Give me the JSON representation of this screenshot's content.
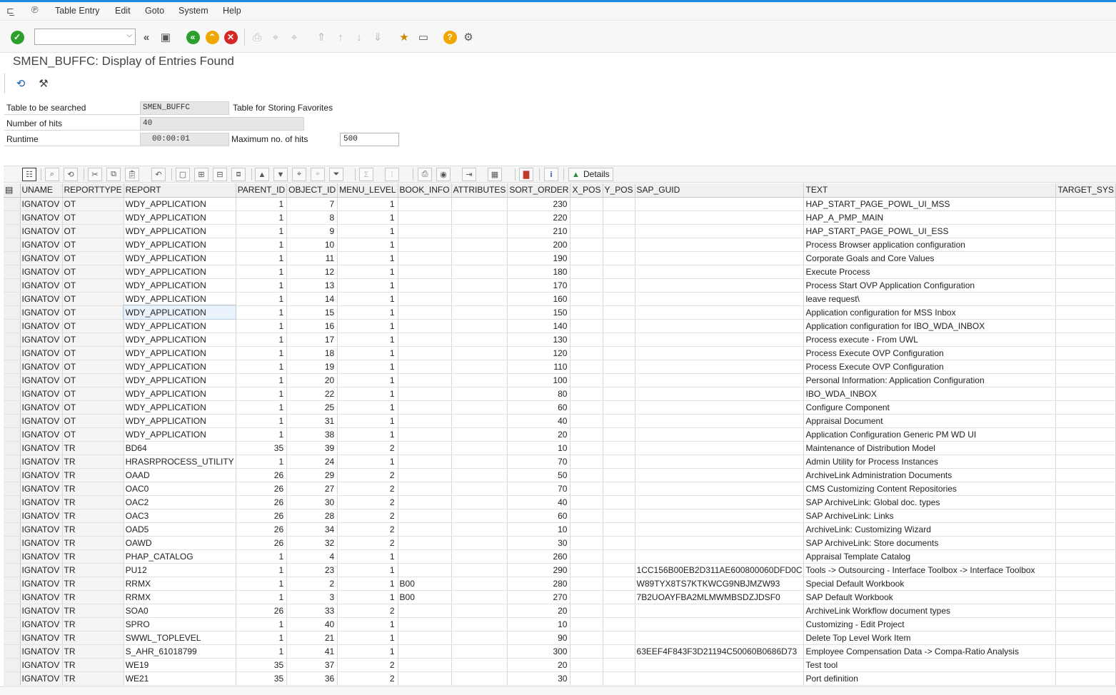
{
  "menu": {
    "items": [
      "Table Entry",
      "Edit",
      "Goto",
      "System",
      "Help"
    ]
  },
  "toolbar": {
    "command_field_value": ""
  },
  "page": {
    "title": "SMEN_BUFFC: Display of Entries Found"
  },
  "header": {
    "table_label": "Table to be searched",
    "table_value": "SMEN_BUFFC",
    "table_desc": "Table for Storing Favorites",
    "hits_label": "Number of hits",
    "hits_value": "40",
    "runtime_label": "Runtime",
    "runtime_value": "00:00:01",
    "maxhits_label": "Maximum no. of hits",
    "maxhits_value": "500"
  },
  "grid_toolbar": {
    "details_label": "Details"
  },
  "table": {
    "columns": [
      "UNAME",
      "REPORTTYPE",
      "REPORT",
      "PARENT_ID",
      "OBJECT_ID",
      "MENU_LEVEL",
      "BOOK_INFO",
      "ATTRIBUTES",
      "SORT_ORDER",
      "X_POS",
      "Y_POS",
      "SAP_GUID",
      "TEXT",
      "TARGET_SYS"
    ],
    "rows": [
      [
        "IGNATOV",
        "OT",
        "WDY_APPLICATION",
        "1",
        "7",
        "1",
        "",
        "",
        "230",
        "",
        "",
        "",
        "HAP_START_PAGE_POWL_UI_MSS",
        ""
      ],
      [
        "IGNATOV",
        "OT",
        "WDY_APPLICATION",
        "1",
        "8",
        "1",
        "",
        "",
        "220",
        "",
        "",
        "",
        "HAP_A_PMP_MAIN",
        ""
      ],
      [
        "IGNATOV",
        "OT",
        "WDY_APPLICATION",
        "1",
        "9",
        "1",
        "",
        "",
        "210",
        "",
        "",
        "",
        "HAP_START_PAGE_POWL_UI_ESS",
        ""
      ],
      [
        "IGNATOV",
        "OT",
        "WDY_APPLICATION",
        "1",
        "10",
        "1",
        "",
        "",
        "200",
        "",
        "",
        "",
        "Process Browser application configuration",
        ""
      ],
      [
        "IGNATOV",
        "OT",
        "WDY_APPLICATION",
        "1",
        "11",
        "1",
        "",
        "",
        "190",
        "",
        "",
        "",
        "Corporate Goals and Core Values",
        ""
      ],
      [
        "IGNATOV",
        "OT",
        "WDY_APPLICATION",
        "1",
        "12",
        "1",
        "",
        "",
        "180",
        "",
        "",
        "",
        "Execute Process",
        ""
      ],
      [
        "IGNATOV",
        "OT",
        "WDY_APPLICATION",
        "1",
        "13",
        "1",
        "",
        "",
        "170",
        "",
        "",
        "",
        "Process Start OVP Application Configuration",
        ""
      ],
      [
        "IGNATOV",
        "OT",
        "WDY_APPLICATION",
        "1",
        "14",
        "1",
        "",
        "",
        "160",
        "",
        "",
        "",
        "leave request\\",
        ""
      ],
      [
        "IGNATOV",
        "OT",
        "WDY_APPLICATION",
        "1",
        "15",
        "1",
        "",
        "",
        "150",
        "",
        "",
        "",
        "Application configuration for MSS Inbox",
        ""
      ],
      [
        "IGNATOV",
        "OT",
        "WDY_APPLICATION",
        "1",
        "16",
        "1",
        "",
        "",
        "140",
        "",
        "",
        "",
        "Application configuration for IBO_WDA_INBOX",
        ""
      ],
      [
        "IGNATOV",
        "OT",
        "WDY_APPLICATION",
        "1",
        "17",
        "1",
        "",
        "",
        "130",
        "",
        "",
        "",
        "Process execute - From UWL",
        ""
      ],
      [
        "IGNATOV",
        "OT",
        "WDY_APPLICATION",
        "1",
        "18",
        "1",
        "",
        "",
        "120",
        "",
        "",
        "",
        "Process Execute OVP Configuration",
        ""
      ],
      [
        "IGNATOV",
        "OT",
        "WDY_APPLICATION",
        "1",
        "19",
        "1",
        "",
        "",
        "110",
        "",
        "",
        "",
        "Process Execute OVP Configuration",
        ""
      ],
      [
        "IGNATOV",
        "OT",
        "WDY_APPLICATION",
        "1",
        "20",
        "1",
        "",
        "",
        "100",
        "",
        "",
        "",
        "Personal Information: Application Configuration",
        ""
      ],
      [
        "IGNATOV",
        "OT",
        "WDY_APPLICATION",
        "1",
        "22",
        "1",
        "",
        "",
        "80",
        "",
        "",
        "",
        "IBO_WDA_INBOX",
        ""
      ],
      [
        "IGNATOV",
        "OT",
        "WDY_APPLICATION",
        "1",
        "25",
        "1",
        "",
        "",
        "60",
        "",
        "",
        "",
        "Configure Component",
        ""
      ],
      [
        "IGNATOV",
        "OT",
        "WDY_APPLICATION",
        "1",
        "31",
        "1",
        "",
        "",
        "40",
        "",
        "",
        "",
        "Appraisal Document",
        ""
      ],
      [
        "IGNATOV",
        "OT",
        "WDY_APPLICATION",
        "1",
        "38",
        "1",
        "",
        "",
        "20",
        "",
        "",
        "",
        "Application Configuration Generic PM WD UI",
        ""
      ],
      [
        "IGNATOV",
        "TR",
        "BD64",
        "35",
        "39",
        "2",
        "",
        "",
        "10",
        "",
        "",
        "",
        "Maintenance of Distribution Model",
        ""
      ],
      [
        "IGNATOV",
        "TR",
        "HRASRPROCESS_UTILITY",
        "1",
        "24",
        "1",
        "",
        "",
        "70",
        "",
        "",
        "",
        "Admin Utility for Process Instances",
        ""
      ],
      [
        "IGNATOV",
        "TR",
        "OAAD",
        "26",
        "29",
        "2",
        "",
        "",
        "50",
        "",
        "",
        "",
        "ArchiveLink Administration Documents",
        ""
      ],
      [
        "IGNATOV",
        "TR",
        "OAC0",
        "26",
        "27",
        "2",
        "",
        "",
        "70",
        "",
        "",
        "",
        "CMS Customizing Content Repositories",
        ""
      ],
      [
        "IGNATOV",
        "TR",
        "OAC2",
        "26",
        "30",
        "2",
        "",
        "",
        "40",
        "",
        "",
        "",
        "SAP ArchiveLink: Global doc. types",
        ""
      ],
      [
        "IGNATOV",
        "TR",
        "OAC3",
        "26",
        "28",
        "2",
        "",
        "",
        "60",
        "",
        "",
        "",
        "SAP ArchiveLink: Links",
        ""
      ],
      [
        "IGNATOV",
        "TR",
        "OAD5",
        "26",
        "34",
        "2",
        "",
        "",
        "10",
        "",
        "",
        "",
        "ArchiveLink: Customizing Wizard",
        ""
      ],
      [
        "IGNATOV",
        "TR",
        "OAWD",
        "26",
        "32",
        "2",
        "",
        "",
        "30",
        "",
        "",
        "",
        "SAP ArchiveLink: Store documents",
        ""
      ],
      [
        "IGNATOV",
        "TR",
        "PHAP_CATALOG",
        "1",
        "4",
        "1",
        "",
        "",
        "260",
        "",
        "",
        "",
        "Appraisal Template Catalog",
        ""
      ],
      [
        "IGNATOV",
        "TR",
        "PU12",
        "1",
        "23",
        "1",
        "",
        "",
        "290",
        "",
        "",
        "1CC156B00EB2D311AE600800060DFD0C",
        "Tools -> Outsourcing - Interface Toolbox -> Interface Toolbox",
        ""
      ],
      [
        "IGNATOV",
        "TR",
        "RRMX",
        "1",
        "2",
        "1",
        "B00",
        "",
        "280",
        "",
        "",
        "W89TYX8TS7KTKWCG9NBJMZW93",
        "Special Default Workbook",
        ""
      ],
      [
        "IGNATOV",
        "TR",
        "RRMX",
        "1",
        "3",
        "1",
        "B00",
        "",
        "270",
        "",
        "",
        "7B2UOAYFBA2MLMWMBSDZJDSF0",
        "SAP Default Workbook",
        ""
      ],
      [
        "IGNATOV",
        "TR",
        "SOA0",
        "26",
        "33",
        "2",
        "",
        "",
        "20",
        "",
        "",
        "",
        "ArchiveLink Workflow document types",
        ""
      ],
      [
        "IGNATOV",
        "TR",
        "SPRO",
        "1",
        "40",
        "1",
        "",
        "",
        "10",
        "",
        "",
        "",
        "Customizing - Edit Project",
        ""
      ],
      [
        "IGNATOV",
        "TR",
        "SWWL_TOPLEVEL",
        "1",
        "21",
        "1",
        "",
        "",
        "90",
        "",
        "",
        "",
        "Delete Top Level Work Item",
        ""
      ],
      [
        "IGNATOV",
        "TR",
        "S_AHR_61018799",
        "1",
        "41",
        "1",
        "",
        "",
        "300",
        "",
        "",
        "63EEF4F843F3D21194C50060B0686D73",
        "Employee Compensation Data -> Compa-Ratio Analysis",
        ""
      ],
      [
        "IGNATOV",
        "TR",
        "WE19",
        "35",
        "37",
        "2",
        "",
        "",
        "20",
        "",
        "",
        "",
        "Test tool",
        ""
      ],
      [
        "IGNATOV",
        "TR",
        "WE21",
        "35",
        "36",
        "2",
        "",
        "",
        "30",
        "",
        "",
        "",
        "Port definition",
        ""
      ]
    ]
  },
  "icons": {
    "enter": "check-circle-green",
    "back": "back-green",
    "exit": "exit-yellow",
    "cancel": "cancel-red",
    "help": "help-yellow",
    "settings": "gear"
  },
  "colors": {
    "accent_line": "#1c8be0",
    "ok_green": "#2ca02c",
    "exit_yellow": "#f0a800",
    "cancel_red": "#d62728",
    "header_bg": "#f0f0f0"
  }
}
